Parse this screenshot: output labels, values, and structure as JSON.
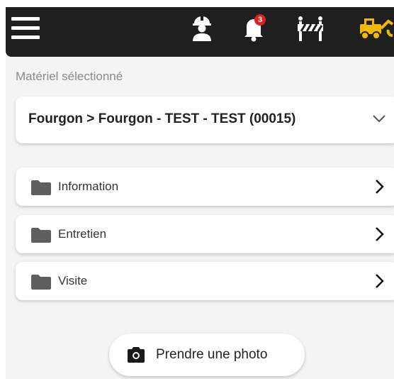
{
  "topbar": {
    "notification_count": "3",
    "accent_color": "#f5b800",
    "icons": [
      "menu-icon",
      "worker-icon",
      "bell-icon",
      "barrier-icon",
      "vehicle-icon"
    ]
  },
  "equipment": {
    "section_label": "Matériel sélectionné",
    "selected_value": "Fourgon > Fourgon - TEST - TEST (00015)"
  },
  "folders": [
    {
      "label": "Information"
    },
    {
      "label": "Entretien"
    },
    {
      "label": "Visite"
    }
  ],
  "photo_button": {
    "label": "Prendre une photo"
  }
}
